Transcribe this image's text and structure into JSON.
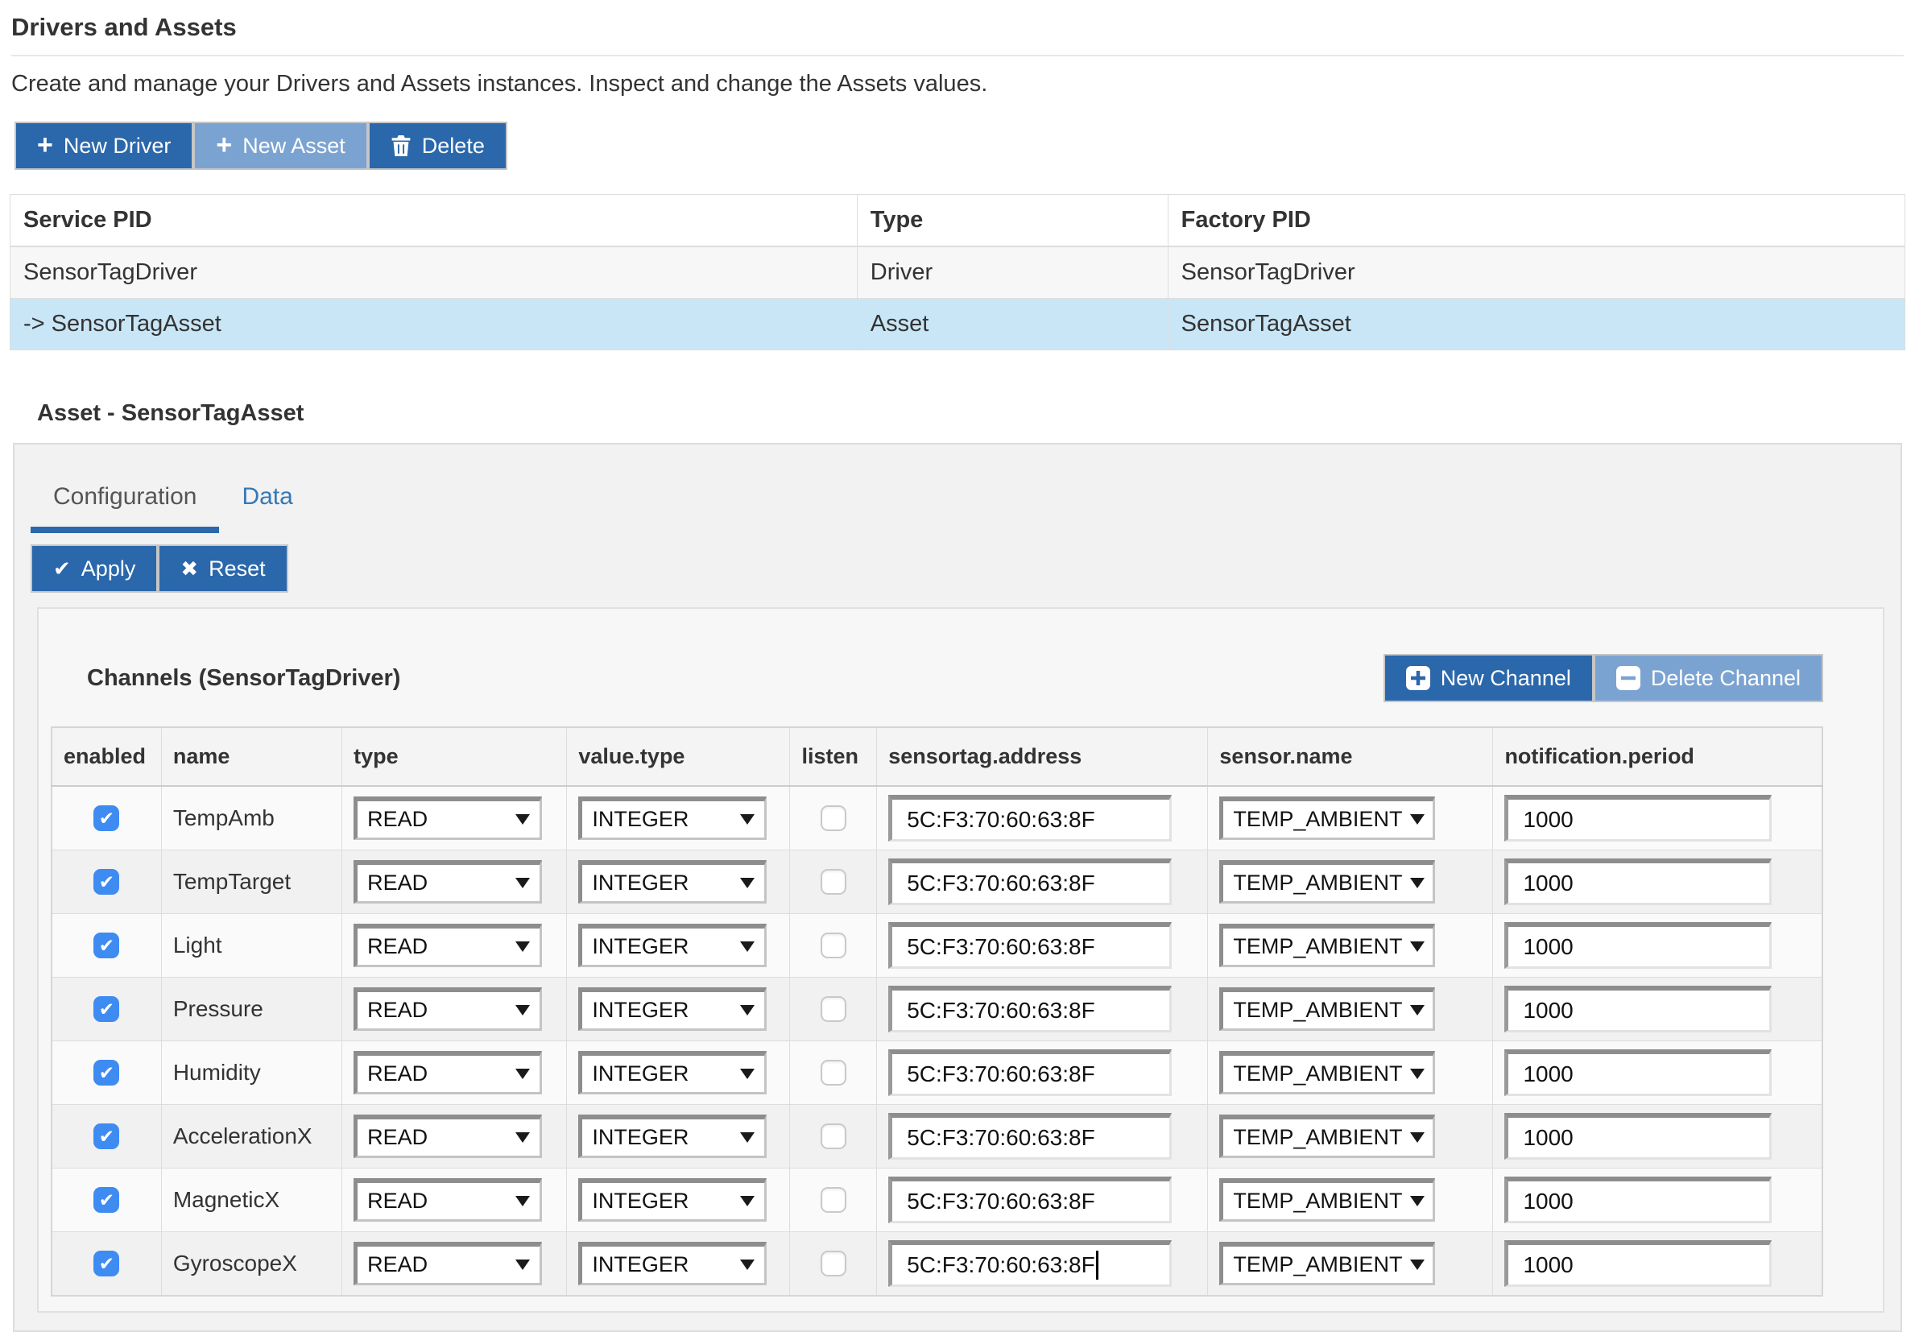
{
  "page": {
    "title": "Drivers and Assets",
    "description": "Create and manage your Drivers and Assets instances. Inspect and change the Assets values."
  },
  "toolbar": {
    "new_driver_label": "New Driver",
    "new_asset_label": "New Asset",
    "delete_label": "Delete",
    "icons": {
      "new_driver": "plus-icon",
      "new_asset": "plus-icon",
      "delete": "trash-icon"
    }
  },
  "instances_table": {
    "columns": [
      "Service PID",
      "Type",
      "Factory PID"
    ],
    "rows": [
      {
        "service_pid": "SensorTagDriver",
        "type": "Driver",
        "factory_pid": "SensorTagDriver",
        "selected": false
      },
      {
        "service_pid": "-> SensorTagAsset",
        "type": "Asset",
        "factory_pid": "SensorTagAsset",
        "selected": true
      }
    ]
  },
  "asset_panel": {
    "title": "Asset - SensorTagAsset",
    "tabs": [
      {
        "label": "Configuration",
        "active": true
      },
      {
        "label": "Data",
        "active": false
      }
    ],
    "apply_label": "Apply",
    "reset_label": "Reset",
    "icons": {
      "apply": "check-icon",
      "reset": "x-icon"
    }
  },
  "channels": {
    "title": "Channels (SensorTagDriver)",
    "new_channel_label": "New Channel",
    "delete_channel_label": "Delete Channel",
    "icons": {
      "new_channel": "plus-square-icon",
      "delete_channel": "minus-square-icon"
    },
    "columns": [
      "enabled",
      "name",
      "type",
      "value.type",
      "listen",
      "sensortag.address",
      "sensor.name",
      "notification.period"
    ],
    "rows": [
      {
        "enabled": true,
        "name": "TempAmb",
        "type": "READ",
        "value_type": "INTEGER",
        "listen": false,
        "sensortag_address": "5C:F3:70:60:63:8F",
        "sensor_name": "TEMP_AMBIENT",
        "notification_period": "1000",
        "caret": false
      },
      {
        "enabled": true,
        "name": "TempTarget",
        "type": "READ",
        "value_type": "INTEGER",
        "listen": false,
        "sensortag_address": "5C:F3:70:60:63:8F",
        "sensor_name": "TEMP_AMBIENT",
        "notification_period": "1000",
        "caret": false
      },
      {
        "enabled": true,
        "name": "Light",
        "type": "READ",
        "value_type": "INTEGER",
        "listen": false,
        "sensortag_address": "5C:F3:70:60:63:8F",
        "sensor_name": "TEMP_AMBIENT",
        "notification_period": "1000",
        "caret": false
      },
      {
        "enabled": true,
        "name": "Pressure",
        "type": "READ",
        "value_type": "INTEGER",
        "listen": false,
        "sensortag_address": "5C:F3:70:60:63:8F",
        "sensor_name": "TEMP_AMBIENT",
        "notification_period": "1000",
        "caret": false
      },
      {
        "enabled": true,
        "name": "Humidity",
        "type": "READ",
        "value_type": "INTEGER",
        "listen": false,
        "sensortag_address": "5C:F3:70:60:63:8F",
        "sensor_name": "TEMP_AMBIENT",
        "notification_period": "1000",
        "caret": false
      },
      {
        "enabled": true,
        "name": "AccelerationX",
        "type": "READ",
        "value_type": "INTEGER",
        "listen": false,
        "sensortag_address": "5C:F3:70:60:63:8F",
        "sensor_name": "TEMP_AMBIENT",
        "notification_period": "1000",
        "caret": false
      },
      {
        "enabled": true,
        "name": "MagneticX",
        "type": "READ",
        "value_type": "INTEGER",
        "listen": false,
        "sensortag_address": "5C:F3:70:60:63:8F",
        "sensor_name": "TEMP_AMBIENT",
        "notification_period": "1000",
        "caret": false
      },
      {
        "enabled": true,
        "name": "GyroscopeX",
        "type": "READ",
        "value_type": "INTEGER",
        "listen": false,
        "sensortag_address": "5C:F3:70:60:63:8F",
        "sensor_name": "TEMP_AMBIENT",
        "notification_period": "1000",
        "caret": true
      }
    ]
  },
  "colors": {
    "primary_button": "#2a67ab",
    "secondary_button": "#7ba3d2",
    "selected_row": "#c9e6f6",
    "tab_active_underline": "#2a67ab",
    "link_blue": "#3279b8",
    "checkbox_checked": "#3e8bf2"
  }
}
